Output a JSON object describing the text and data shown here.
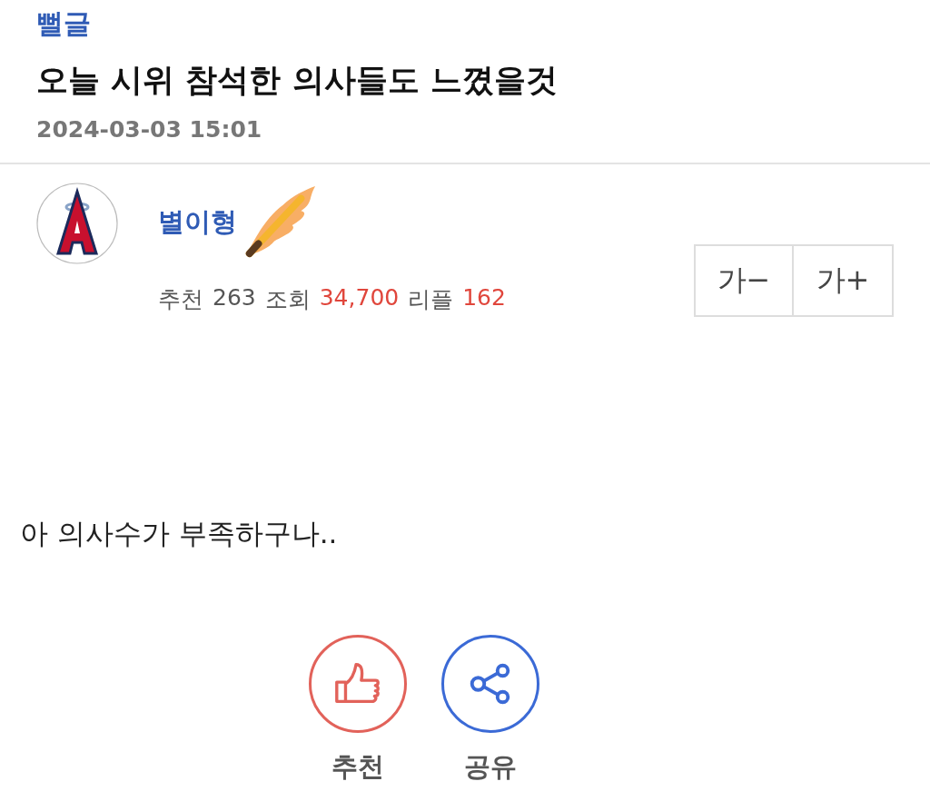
{
  "category": "뻘글",
  "title": "오늘 시위 참석한 의사들도 느꼈을것",
  "date": "2024-03-03 15:01",
  "author": {
    "name": "별이형"
  },
  "stats": [
    {
      "label": "추천",
      "value": "263",
      "color": "#555555"
    },
    {
      "label": "조회",
      "value": "34,700",
      "color": "#e0463c"
    },
    {
      "label": "리플",
      "value": "162",
      "color": "#e0463c"
    }
  ],
  "font_buttons": [
    "가−",
    "가+"
  ],
  "body": "아 의사수가 부족하구나..",
  "actions": [
    {
      "kind": "like",
      "label": "추천",
      "color": "#e2625a"
    },
    {
      "kind": "share",
      "label": "공유",
      "color": "#3b6ad6"
    }
  ]
}
